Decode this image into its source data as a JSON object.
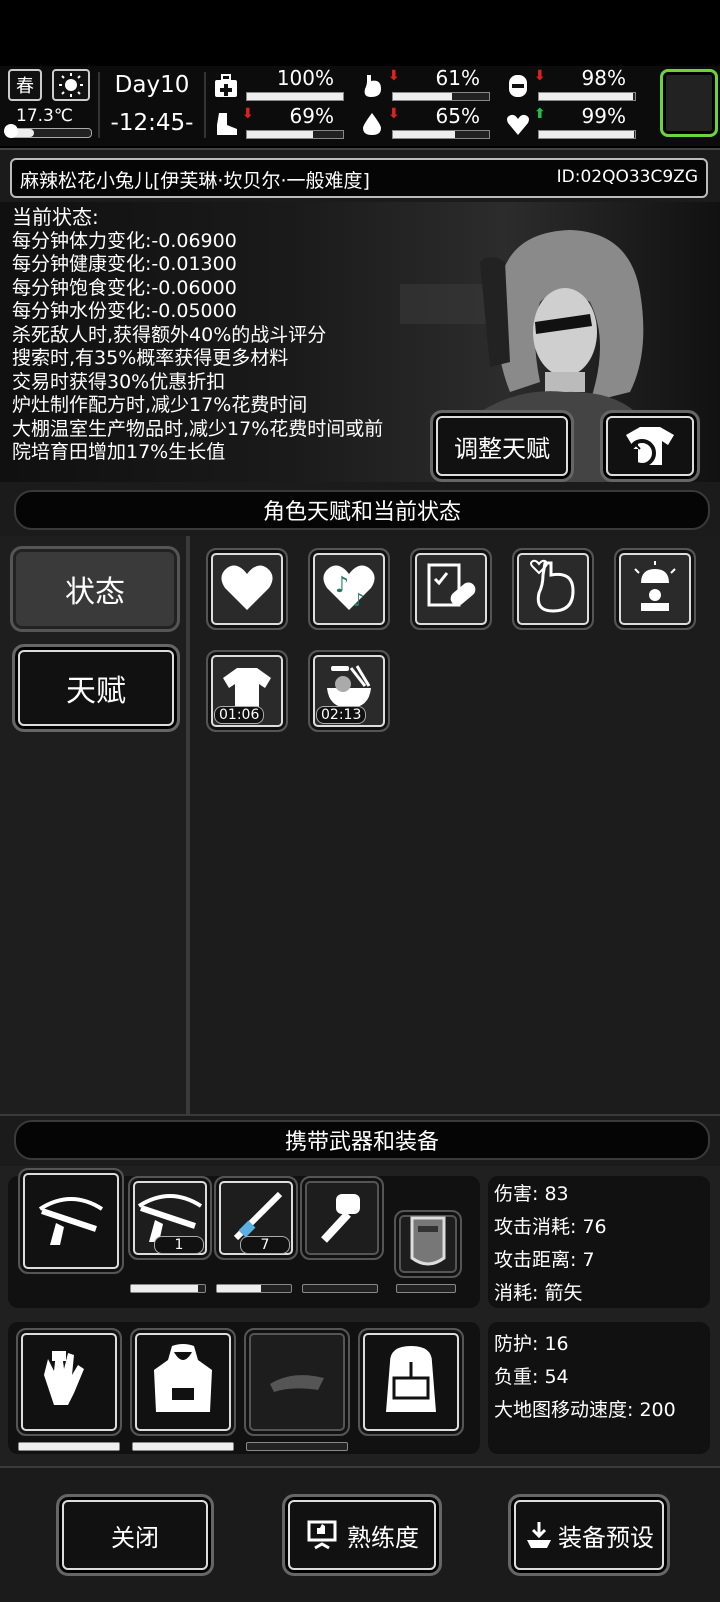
{
  "hud": {
    "season": "春",
    "temperature": "17.3℃",
    "temperature_level": 0.3,
    "day": "Day10",
    "time": "-12:45-",
    "stats": [
      {
        "icon": "medkit-icon",
        "value": "100%",
        "level": 1.0,
        "arrow": ""
      },
      {
        "icon": "stomach-icon",
        "value": "61%",
        "level": 0.61,
        "arrow": "down"
      },
      {
        "icon": "mood-face-icon",
        "value": "98%",
        "level": 0.98,
        "arrow": "down"
      },
      {
        "icon": "boot-icon",
        "value": "69%",
        "level": 0.69,
        "arrow": "down"
      },
      {
        "icon": "water-drop-icon",
        "value": "65%",
        "level": 0.65,
        "arrow": "down"
      },
      {
        "icon": "heart-hand-icon",
        "value": "99%",
        "level": 0.99,
        "arrow": "up"
      }
    ],
    "arrow_down_color": "#e02020",
    "arrow_up_color": "#20c040",
    "menu_frame_color": "#6cd43a"
  },
  "character": {
    "name": "麻辣松花小兔儿[伊芙琳·坎贝尔·一般难度]",
    "id": "ID:02QO33C9ZG",
    "status_title": "当前状态:",
    "status_lines": [
      "每分钟体力变化:-0.06900",
      "每分钟健康变化:-0.01300",
      "每分钟饱食变化:-0.06000",
      "每分钟水份变化:-0.05000",
      "杀死敌人时,获得额外40%的战斗评分",
      "搜索时,有35%概率获得更多材料",
      "交易时获得30%优惠折扣",
      "炉灶制作配方时,减少17%花费时间",
      "大棚温室生产物品时,减少17%花费时间或前",
      "院培育田增加17%生长值"
    ],
    "adjust_talent_label": "调整天赋"
  },
  "talent_section": {
    "title": "角色天赋和当前状态",
    "tabs": [
      "状态",
      "天赋"
    ],
    "effects": [
      {
        "icon": "heart-icon",
        "timer": ""
      },
      {
        "icon": "music-heart-icon",
        "timer": ""
      },
      {
        "icon": "medicine-clipboard-icon",
        "timer": ""
      },
      {
        "icon": "stomach-heart-icon",
        "timer": ""
      },
      {
        "icon": "alarm-person-icon",
        "timer": ""
      },
      {
        "icon": "clothes-icon",
        "timer": "01:06"
      },
      {
        "icon": "food-bowl-icon",
        "timer": "02:13"
      }
    ]
  },
  "equipment_section": {
    "title": "携带武器和装备",
    "weapons": [
      {
        "icon": "crossbow-icon",
        "count": "",
        "durability": null
      },
      {
        "icon": "crossbow-icon",
        "count": "1",
        "durability": 0.9
      },
      {
        "icon": "rifle-icon",
        "count": "7",
        "durability": 0.6
      },
      {
        "icon": "fist-icon",
        "count": "",
        "durability": 0
      },
      {
        "icon": "shield-icon",
        "count": "",
        "durability": 0
      }
    ],
    "weapon_stats": [
      "伤害: 83",
      "攻击消耗: 76",
      "攻击距离: 7",
      "消耗: 箭矢"
    ],
    "gear": [
      {
        "icon": "gloves-icon",
        "durability": 1.0
      },
      {
        "icon": "hoodie-icon",
        "durability": 1.0
      },
      {
        "icon": "cap-icon",
        "durability": 0
      },
      {
        "icon": "backpack-icon",
        "durability": null
      }
    ],
    "gear_stats": [
      "防护: 16",
      "负重: 54",
      "大地图移动速度: 200"
    ]
  },
  "footer": {
    "close_label": "关闭",
    "proficiency_label": "熟练度",
    "preset_label": "装备预设"
  }
}
